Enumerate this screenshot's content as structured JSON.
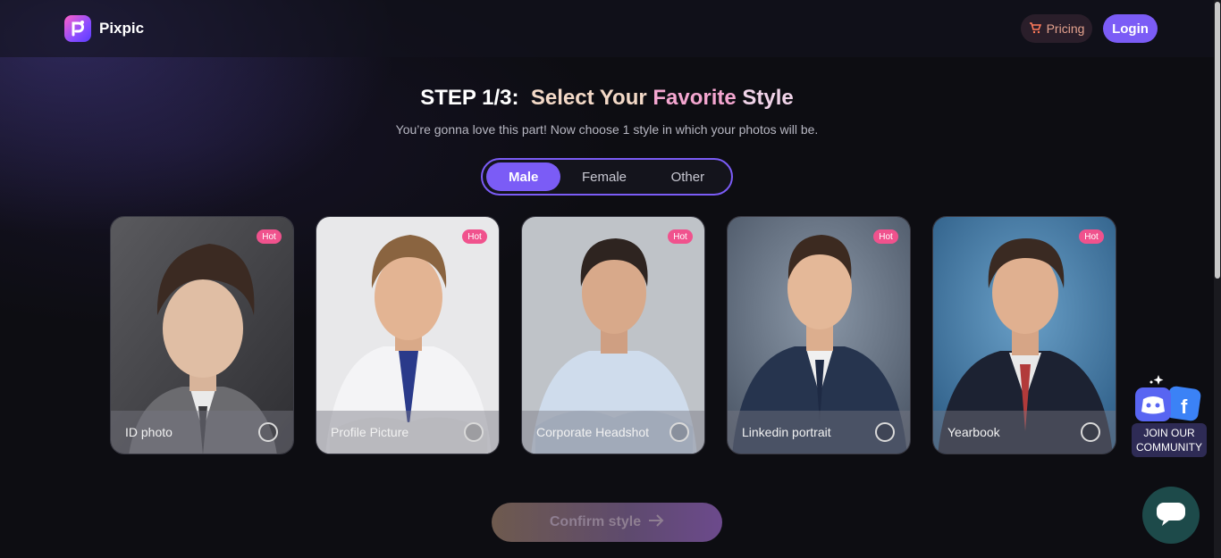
{
  "app": {
    "name": "Pixpic"
  },
  "header": {
    "pricing_label": "Pricing",
    "login_label": "Login"
  },
  "heading": {
    "step": "STEP 1/3:",
    "title_part1": "Select Your ",
    "title_part2": "Favorite",
    "title_part3": " Style",
    "subtitle": "You’re gonna love this part! Now choose 1 style in which your photos will be."
  },
  "gender_options": [
    {
      "label": "Male",
      "selected": true
    },
    {
      "label": "Female",
      "selected": false
    },
    {
      "label": "Other",
      "selected": false
    }
  ],
  "styles": [
    {
      "label": "ID photo",
      "badge": "Hot",
      "selected": false
    },
    {
      "label": "Profile Picture",
      "badge": "Hot",
      "selected": false
    },
    {
      "label": "Corporate Headshot",
      "badge": "Hot",
      "selected": false
    },
    {
      "label": "Linkedin portrait",
      "badge": "Hot",
      "selected": false
    },
    {
      "label": "Yearbook",
      "badge": "Hot",
      "selected": false
    }
  ],
  "confirm_label": "Confirm style",
  "community": {
    "line1": "JOIN OUR",
    "line2": "COMMUNITY"
  },
  "colors": {
    "accent": "#7b5cf6",
    "hot_badge": "#f0528d",
    "background": "#0d0d12"
  }
}
